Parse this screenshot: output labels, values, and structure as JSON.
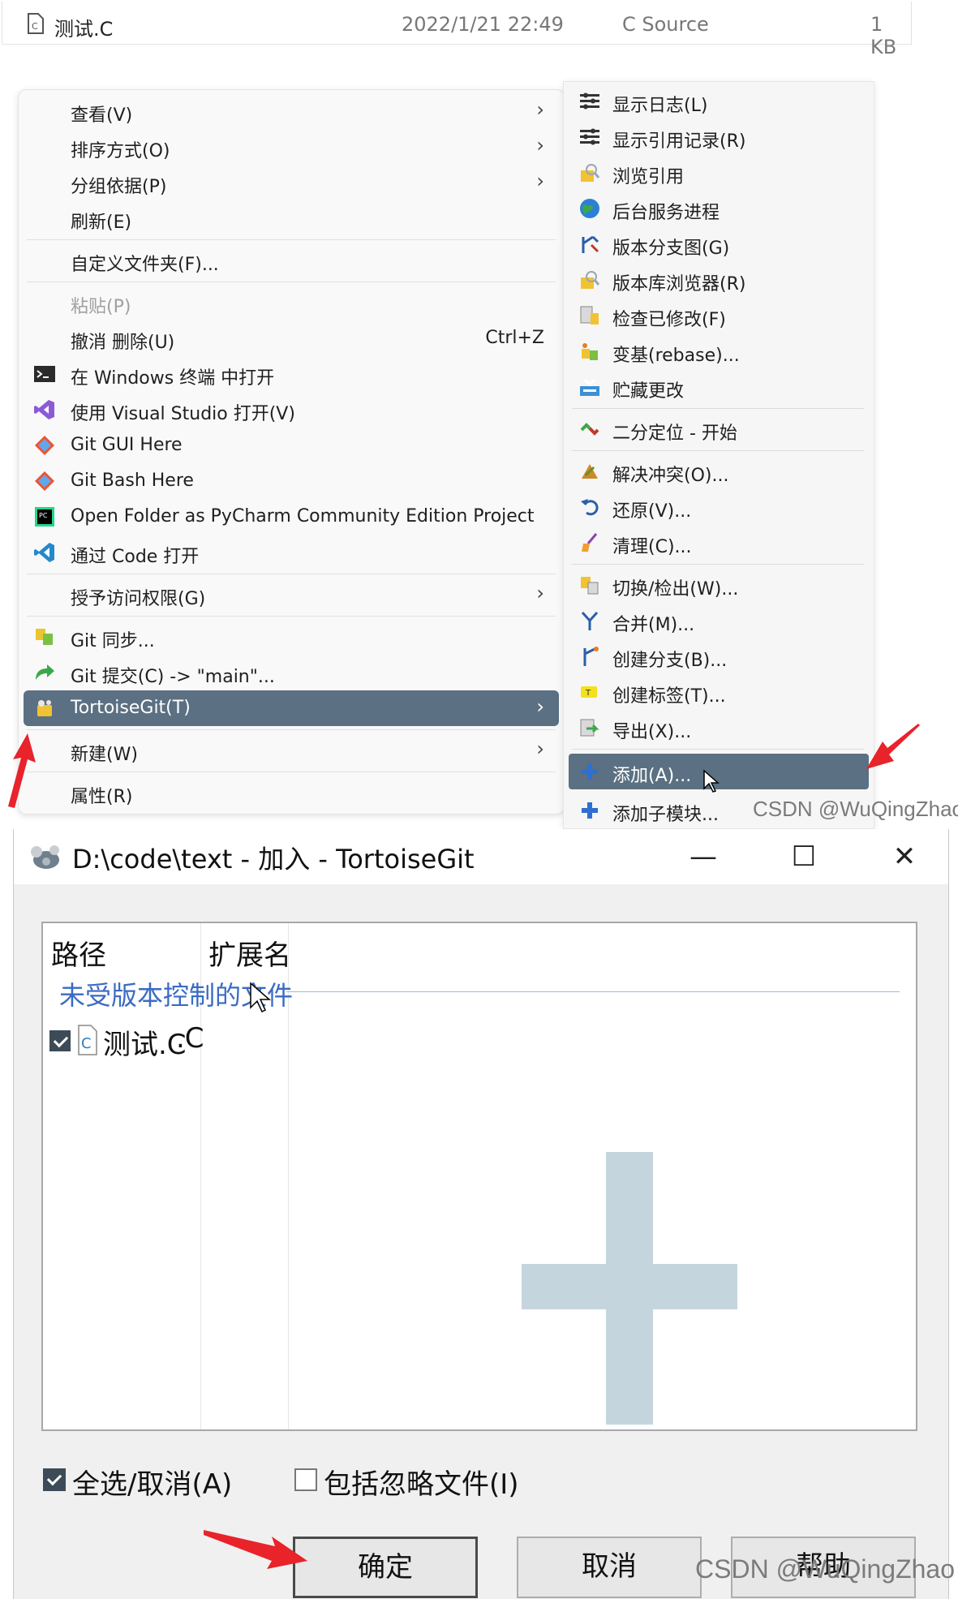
{
  "file_row": {
    "name": "测试.C",
    "date": "2022/1/21 22:49",
    "type": "C Source",
    "size": "1 KB"
  },
  "context_menu": {
    "view": "查看(V)",
    "sort": "排序方式(O)",
    "group": "分组依据(P)",
    "refresh": "刷新(E)",
    "customize": "自定义文件夹(F)...",
    "paste": "粘贴(P)",
    "undo": "撤消 删除(U)",
    "undo_shortcut": "Ctrl+Z",
    "terminal": "在 Windows 终端 中打开",
    "vs": "使用 Visual Studio 打开(V)",
    "git_gui": "Git GUI Here",
    "git_bash": "Git Bash Here",
    "pycharm": "Open Folder as PyCharm Community Edition Project",
    "vscode": "通过 Code 打开",
    "access": "授予访问权限(G)",
    "git_sync": "Git 同步...",
    "git_commit": "Git 提交(C) -> \"main\"...",
    "tortoise": "TortoiseGit(T)",
    "new": "新建(W)",
    "props": "属性(R)"
  },
  "submenu": {
    "show_log": "显示日志(L)",
    "show_reflog": "显示引用记录(R)",
    "browse_refs": "浏览引用",
    "daemon": "后台服务进程",
    "rev_graph": "版本分支图(G)",
    "repo_browser": "版本库浏览器(R)",
    "check_mod": "检查已修改(F)",
    "rebase": "变基(rebase)...",
    "stash": "贮藏更改",
    "bisect": "二分定位 - 开始",
    "resolve": "解决冲突(O)...",
    "revert": "还原(V)...",
    "cleanup": "清理(C)...",
    "switch": "切换/检出(W)...",
    "merge": "合并(M)...",
    "branch": "创建分支(B)...",
    "tag": "创建标签(T)...",
    "export": "导出(X)...",
    "add": "添加(A)...",
    "add_sub": "添加子模块..."
  },
  "watermark": "CSDN @WuQingZhao",
  "dialog": {
    "title": "D:\\code\\text - 加入 - TortoiseGit",
    "min": "—",
    "max": "☐",
    "close": "✕",
    "col_path": "路径",
    "col_ext": "扩展名",
    "group_label": "未受版本控制的文件",
    "file_name": "测试.C",
    "file_ext": ".C",
    "file_icon_letter": "C",
    "select_all": "全选/取消(A)",
    "include_ignored": "包括忽略文件(I)",
    "ok": "确定",
    "cancel": "取消",
    "help": "帮助"
  },
  "colors": {
    "highlight": "#5b7082",
    "group_link": "#3a6bc4",
    "arrow": "#e8232a",
    "plus_watermark": "#c5d5dd"
  }
}
